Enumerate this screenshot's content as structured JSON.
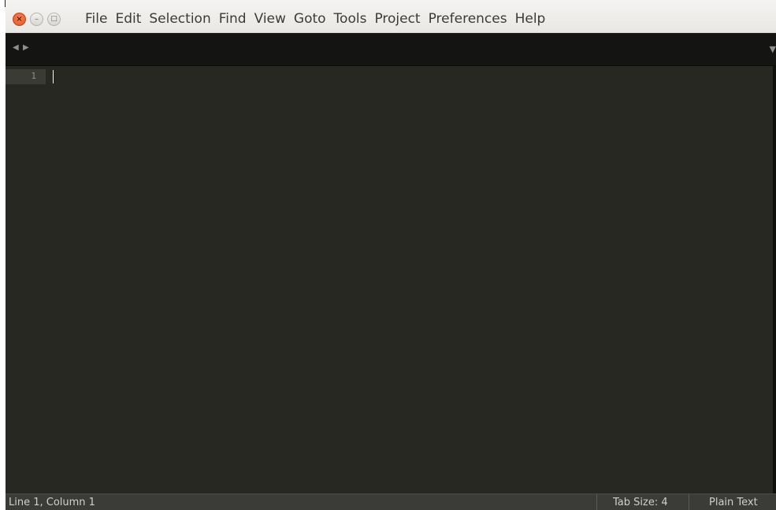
{
  "window": {
    "controls": {
      "close_glyph": "×",
      "minimize_glyph": "–",
      "maximize_glyph": "□"
    }
  },
  "menubar": {
    "items": [
      "File",
      "Edit",
      "Selection",
      "Find",
      "View",
      "Goto",
      "Tools",
      "Project",
      "Preferences",
      "Help"
    ]
  },
  "tabstrip": {
    "prev_icon": "triangle-left-icon",
    "next_icon": "triangle-right-icon",
    "dropdown_icon": "triangle-down-icon"
  },
  "editor": {
    "line_numbers": [
      "1"
    ],
    "content": ""
  },
  "statusbar": {
    "position": "Line 1, Column 1",
    "tab_size": "Tab Size: 4",
    "syntax": "Plain Text"
  },
  "colors": {
    "editor_background": "#272822",
    "tabstrip_background": "#141413",
    "statusbar_background": "#3b3c38",
    "close_button": "#e2531f"
  }
}
